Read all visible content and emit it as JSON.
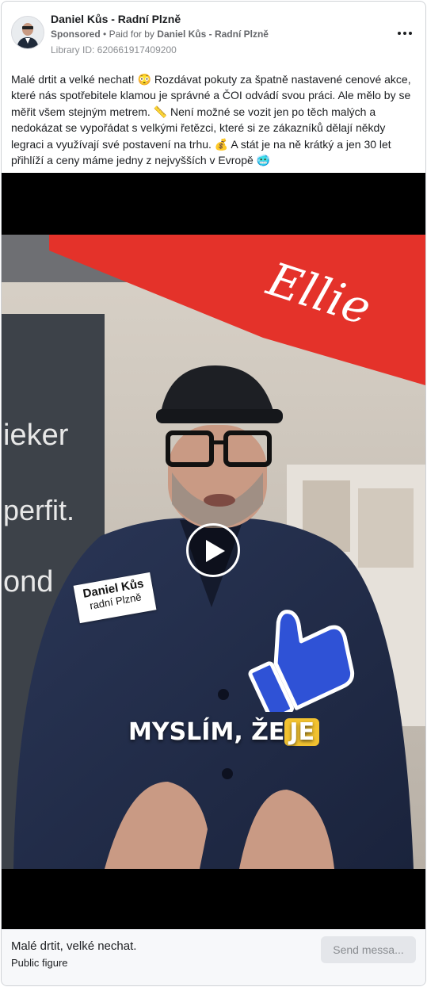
{
  "post": {
    "page_name": "Daniel Kůs - Radní Plzně",
    "sponsored_label": "Sponsored",
    "paid_prefix": "Paid for by",
    "paid_by": "Daniel Kůs - Radní Plzně",
    "library_id": "Library ID: 620661917409200",
    "more_icon": "more-horizontal-icon",
    "body": "Malé drtit a velké nechat! 😳 Rozdávat pokuty za špatně nastavené cenové akce, které nás spotřebitele klamou je správné a ČOI odvádí svou práci. Ale mělo by se měřit všem stejným metrem. 📏 Není možné se vozit jen po těch malých a nedokázat se vypořádat s velkými řetězci, které si ze zákazníků dělají někdy legraci a využívají své postavení na trhu. 💰 A stát je na ně krátký a jen 30 let přihlíží a ceny máme jedny z nejvyšších v Evropě 🥶"
  },
  "video": {
    "store_sign": "Ellie",
    "left_banner_1": "ieker",
    "left_banner_2": "perfit.",
    "left_banner_3": "ond",
    "name_tag_line1": "Daniel Kůs",
    "name_tag_line2": "radní Plzně",
    "subtitle_main": "MYSLÍM, ŽE",
    "subtitle_highlight": "JE",
    "play_icon": "play-icon",
    "thumb_icon": "thumbs-up-icon"
  },
  "cta": {
    "title": "Malé drtit, velké nechat.",
    "subtitle": "Public figure",
    "button_label": "Send messa..."
  }
}
